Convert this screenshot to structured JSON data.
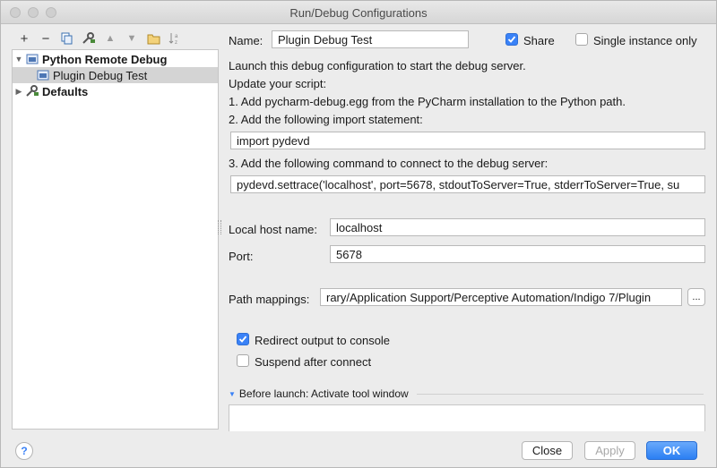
{
  "window": {
    "title": "Run/Debug Configurations"
  },
  "toolbar": {
    "add": "+",
    "remove": "−",
    "copy_icon": "copy-icon",
    "edit_defaults_icon": "wrench-icon",
    "move_up": "▲",
    "move_down": "▼",
    "folder_icon": "folder-icon",
    "sort_icon": "sort-icon"
  },
  "tree": {
    "group": "Python Remote Debug",
    "item": "Plugin Debug Test",
    "defaults": "Defaults"
  },
  "form": {
    "name_label": "Name:",
    "name_value": "Plugin Debug Test",
    "share_label": "Share",
    "share_checked": true,
    "single_instance_label": "Single instance only",
    "single_instance_checked": false,
    "intro1": "Launch this debug configuration to start the debug server.",
    "intro2": "Update your script:",
    "step1": "1. Add pycharm-debug.egg from the PyCharm installation to the Python path.",
    "step2": "2. Add the following import statement:",
    "import_statement": "import pydevd",
    "step3": "3. Add the following command to connect to the debug server:",
    "settrace": "pydevd.settrace('localhost', port=5678, stdoutToServer=True, stderrToServer=True, su",
    "host_label": "Local host name:",
    "host_value": "localhost",
    "port_label": "Port:",
    "port_value": "5678",
    "path_label": "Path mappings:",
    "path_value": "rary/Application Support/Perceptive Automation/Indigo 7/Plugin",
    "browse_label": "...",
    "redirect_label": "Redirect output to console",
    "redirect_checked": true,
    "suspend_label": "Suspend after connect",
    "suspend_checked": false,
    "before_launch": "Before launch: Activate tool window"
  },
  "buttons": {
    "help": "?",
    "close": "Close",
    "apply": "Apply",
    "ok": "OK"
  },
  "colors": {
    "accent": "#3a82f7",
    "selection": "#d4d4d4"
  }
}
